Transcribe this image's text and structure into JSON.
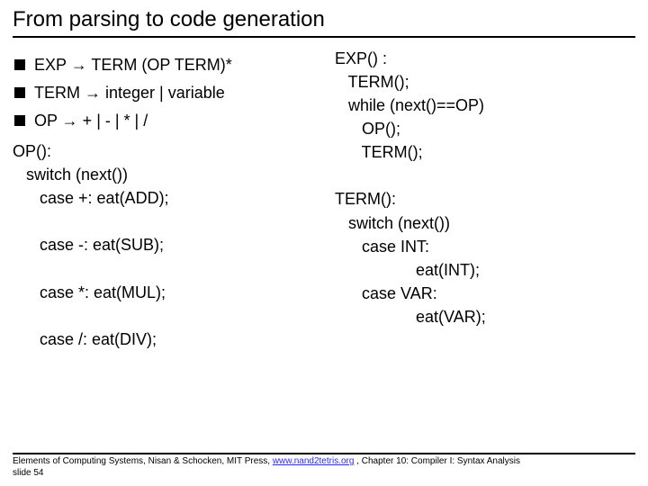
{
  "title": "From parsing to code generation",
  "grammar": {
    "exp": "EXP → TERM (OP TERM)*",
    "term": "TERM → integer | variable",
    "op": "OP → + | - | * | /"
  },
  "left_code": "OP():\n   switch (next())\n      case +: eat(ADD);\n\n      case -: eat(SUB);\n\n      case *: eat(MUL);\n\n      case /: eat(DIV);",
  "right_code_exp": "EXP() :\n   TERM();\n   while (next()==OP)\n      OP();\n      TERM();",
  "right_code_term": "TERM():\n   switch (next())\n      case INT:\n                  eat(INT);\n      case VAR:\n                  eat(VAR);",
  "footer": {
    "pre": "Elements of Computing Systems, Nisan & Schocken, MIT Press, ",
    "link": "www.nand2tetris.org",
    "post": " , Chapter 10: Compiler I: Syntax Analysis",
    "slide": "slide 54"
  }
}
